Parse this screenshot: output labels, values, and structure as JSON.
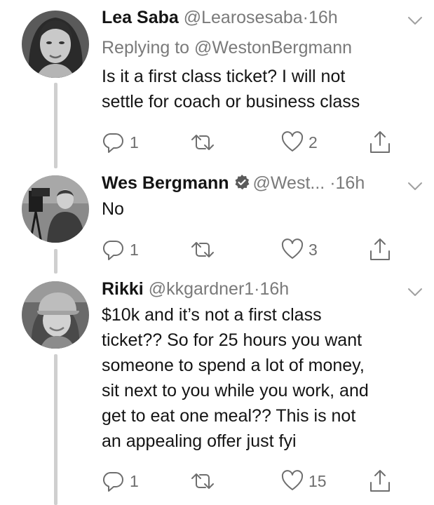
{
  "tweets": [
    {
      "display_name": "Lea Saba",
      "handle": "@Learosesaba",
      "dot": "·",
      "time": "16h",
      "replying_to": "Replying to @WestonBergmann",
      "text": "Is it a first class ticket? I will not\nsettle for coach or business class",
      "reply_count": "1",
      "retweet_count": "",
      "like_count": "2"
    },
    {
      "display_name": "Wes Bergmann",
      "verified": true,
      "handle": "@West...",
      "dot": "·",
      "time": "16h",
      "text": "No",
      "reply_count": "1",
      "retweet_count": "",
      "like_count": "3"
    },
    {
      "display_name": "Rikki",
      "handle": "@kkgardner1",
      "dot": "·",
      "time": "16h",
      "text": "$10k and it’s not a first class\nticket?? So for 25 hours you want\nsomeone to spend a lot of money,\nsit next to you while you work, and\nget to eat one meal?? This is not\nan appealing offer just fyi",
      "reply_count": "1",
      "retweet_count": "",
      "like_count": "15"
    }
  ],
  "icons": {
    "reply": "reply-icon",
    "retweet": "retweet-icon",
    "like": "heart-icon",
    "share": "share-icon",
    "menu": "chevron-down-icon",
    "verified": "verified-badge-icon"
  },
  "colors": {
    "text": "#141414",
    "secondary": "#7a7a7a",
    "icon": "#6e6e6e",
    "thread_line": "#cfcfcf"
  }
}
